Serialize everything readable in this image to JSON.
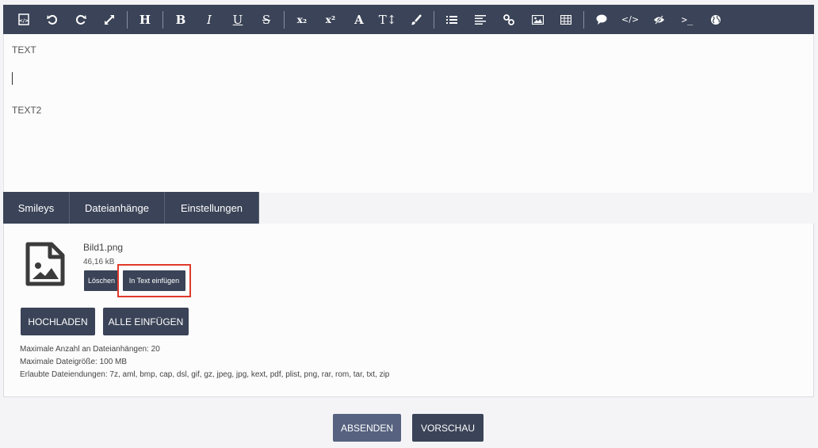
{
  "toolbar": {
    "buttons": [
      {
        "icon": "source-icon"
      },
      {
        "icon": "undo-icon"
      },
      {
        "icon": "redo-icon"
      },
      {
        "icon": "fullscreen-icon"
      },
      {
        "icon": "heading-icon",
        "glyph": "H"
      },
      {
        "icon": "bold-icon",
        "glyph": "B"
      },
      {
        "icon": "italic-icon",
        "glyph": "I"
      },
      {
        "icon": "underline-icon",
        "glyph": "U"
      },
      {
        "icon": "strikethrough-icon",
        "glyph": "S"
      },
      {
        "icon": "subscript-icon",
        "glyph": "x₂"
      },
      {
        "icon": "superscript-icon",
        "glyph": "x²"
      },
      {
        "icon": "font-icon",
        "glyph": "A"
      },
      {
        "icon": "font-size-icon",
        "glyph": "T↕"
      },
      {
        "icon": "color-brush-icon"
      },
      {
        "icon": "list-icon"
      },
      {
        "icon": "align-icon"
      },
      {
        "icon": "link-icon"
      },
      {
        "icon": "image-icon"
      },
      {
        "icon": "table-icon"
      },
      {
        "icon": "quote-icon"
      },
      {
        "icon": "code-icon",
        "glyph": "</>"
      },
      {
        "icon": "spoiler-icon"
      },
      {
        "icon": "terminal-icon",
        "glyph": ">_"
      },
      {
        "icon": "globe-icon"
      }
    ]
  },
  "editor": {
    "line1": "TEXT",
    "line2": "TEXT2"
  },
  "tabs": [
    "Smileys",
    "Dateianhänge",
    "Einstellungen"
  ],
  "attachment": {
    "name": "Bild1.png",
    "size": "46,16 kB",
    "delete_label": "Löschen",
    "insert_label": "In Text einfügen"
  },
  "actions": {
    "upload_label": "HOCHLADEN",
    "insert_all_label": "ALLE EINFÜGEN"
  },
  "info": {
    "max_count": "Maximale Anzahl an Dateianhängen: 20",
    "max_size": "Maximale Dateigröße: 100 MB",
    "extensions": "Erlaubte Dateiendungen: 7z, aml, bmp, cap, dsl, gif, gz, jpeg, jpg, kext, pdf, plist, png, rar, rom, tar, txt, zip"
  },
  "footer": {
    "submit_label": "ABSENDEN",
    "preview_label": "VORSCHAU"
  },
  "colors": {
    "toolbar_bg": "#3a4357",
    "submit_bg": "#56627f",
    "highlight": "#e03a2a"
  }
}
